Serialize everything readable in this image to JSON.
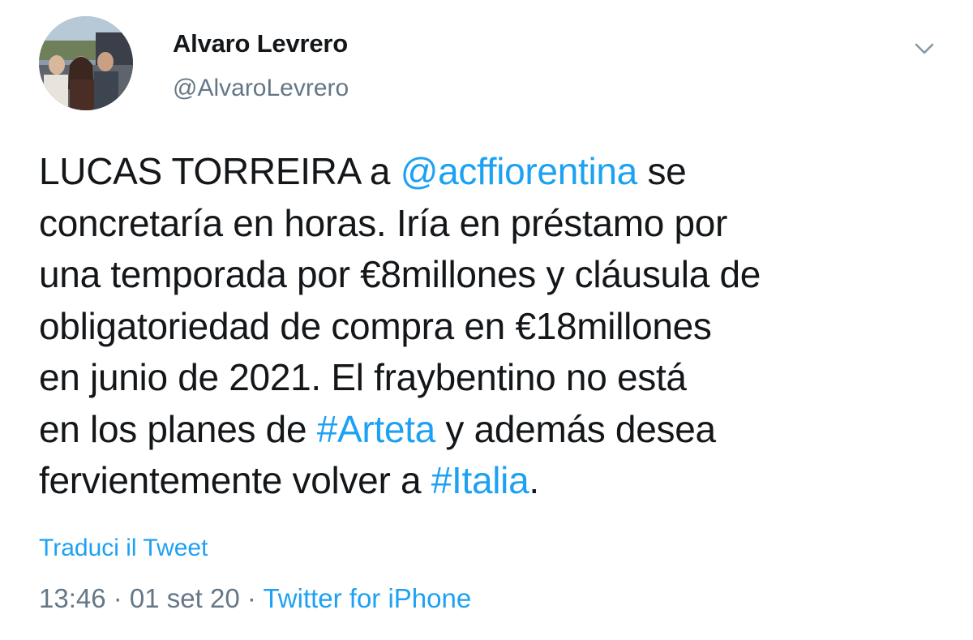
{
  "author": {
    "display_name": "Alvaro Levrero",
    "handle": "@AlvaroLevrero",
    "avatar": "profile-photo"
  },
  "tweet": {
    "lines": [
      [
        {
          "text": "LUCAS TORREIRA a "
        },
        {
          "text": "@acffiorentina",
          "link": true
        },
        {
          "text": " se"
        }
      ],
      [
        {
          "text": "concretaría en horas. Iría en préstamo por"
        }
      ],
      [
        {
          "text": "una temporada por €8millones y cláusula de"
        }
      ],
      [
        {
          "text": "obligatoriedad de compra en €18millones"
        }
      ],
      [
        {
          "text": "en junio de 2021. El fraybentino no está"
        }
      ],
      [
        {
          "text": "en los planes de "
        },
        {
          "text": "#Arteta",
          "link": true
        },
        {
          "text": " y además desea"
        }
      ],
      [
        {
          "text": "fervientemente volver a "
        },
        {
          "text": "#Italia",
          "link": true
        },
        {
          "text": "."
        }
      ]
    ]
  },
  "translate_label": "Traduci il Tweet",
  "meta": {
    "time": "13:46",
    "separator": " · ",
    "date": "01 set 20",
    "source": "Twitter for iPhone"
  },
  "menu_icon": "chevron-down-icon",
  "colors": {
    "text": "#14171a",
    "secondary": "#657786",
    "link": "#1da1f2"
  }
}
